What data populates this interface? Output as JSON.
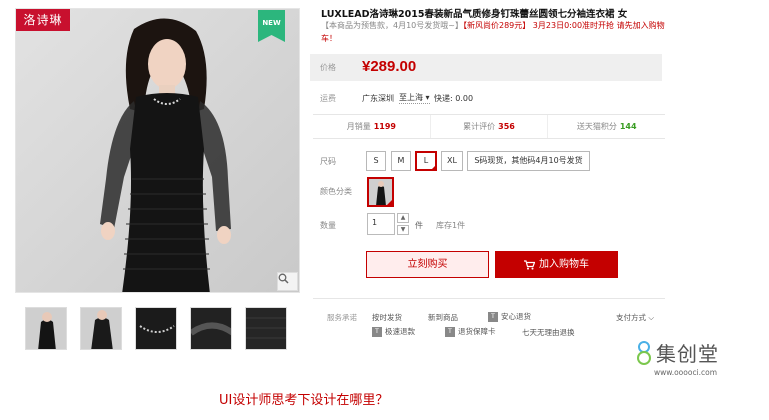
{
  "gallery": {
    "brand_logo": "洛诗琳",
    "new_badge": "NEW",
    "thumbnails": [
      "thumb-1",
      "thumb-2",
      "thumb-3",
      "thumb-4",
      "thumb-5"
    ]
  },
  "product": {
    "title": "LUXLEAD洛诗琳2015春装新品气质修身钉珠蕾丝圆领七分袖连衣裙 女",
    "subtitle_grey": "【本商品为预售款，4月10号发货哦~】",
    "subtitle_red": "【新风尚价289元】 3月23日0:00准时开抢 请先加入购物车！"
  },
  "price": {
    "label": "价格",
    "value": "¥289.00"
  },
  "shipping": {
    "label": "运费",
    "from": "广东深圳",
    "to": "至上海",
    "fee": "快递: 0.00"
  },
  "stats": [
    {
      "label": "月销量",
      "value": "1199"
    },
    {
      "label": "累计评价",
      "value": "356"
    },
    {
      "label": "送天猫积分",
      "value": "144"
    }
  ],
  "size": {
    "label": "尺码",
    "options": [
      "S",
      "M",
      "L",
      "XL",
      "S码现货，其他码4月10号发货"
    ],
    "selected": "L"
  },
  "color": {
    "label": "颜色分类"
  },
  "quantity": {
    "label": "数量",
    "value": "1",
    "unit": "件",
    "stock": "库存1件"
  },
  "actions": {
    "buy_now": "立刻购买",
    "add_cart": "加入购物车"
  },
  "services": {
    "label": "服务承诺",
    "items": [
      "按时发货",
      "新到商品",
      "安心退货",
      "极速退款",
      "退货保障卡",
      "七天无理由退换"
    ],
    "icon_letters": [
      "T",
      "T",
      "T"
    ],
    "pay_method": "支付方式"
  },
  "watermark": {
    "brand": "集创堂",
    "url": "www.ooooci.com"
  },
  "caption": "UI设计师思考下设计在哪里？",
  "colors": {
    "accent": "#c40000",
    "badge_green": "#2cb67d"
  }
}
